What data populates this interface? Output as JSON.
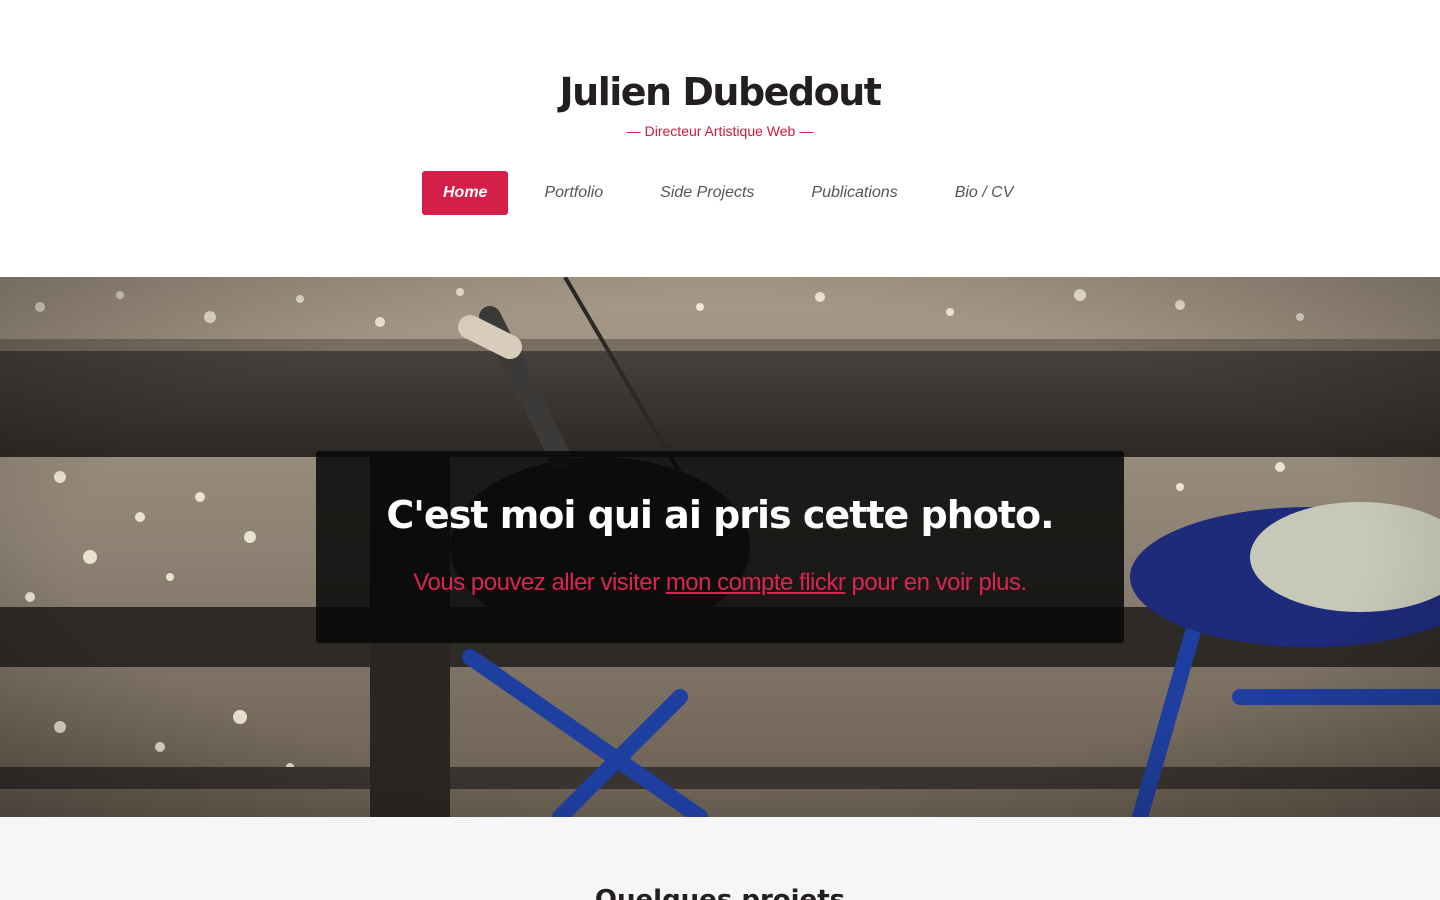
{
  "header": {
    "title": "Julien Dubedout",
    "subtitle": "— Directeur Artistique Web —"
  },
  "nav": {
    "items": [
      {
        "label": "Home",
        "active": true
      },
      {
        "label": "Portfolio",
        "active": false
      },
      {
        "label": "Side Projects",
        "active": false
      },
      {
        "label": "Publications",
        "active": false
      },
      {
        "label": "Bio / CV",
        "active": false
      }
    ]
  },
  "hero": {
    "caption_title": "C'est moi qui ai pris cette photo.",
    "caption_before": "Vous pouvez aller visiter ",
    "caption_link": "mon compte flickr",
    "caption_after": " pour en voir plus."
  },
  "section": {
    "title": "Quelques projets"
  },
  "colors": {
    "accent": "#d42048",
    "title": "#231f20",
    "section_bg": "#f6f6f7"
  }
}
